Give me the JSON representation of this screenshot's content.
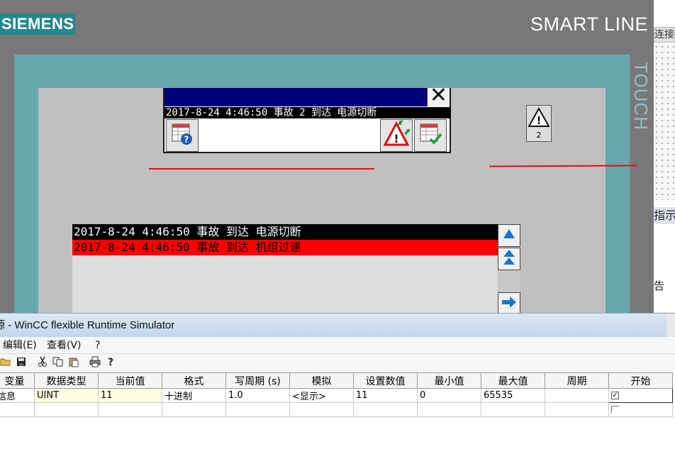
{
  "hmi": {
    "brand": "SIEMENS",
    "model": "SMART LINE",
    "side_label": "TOUCH",
    "alarm_window": {
      "message": "2017-8-24 4:46:50 事故 2 到达 电源切断",
      "close_symbol": "✕"
    },
    "alarm_indicator": {
      "count": "2"
    },
    "alarm_view": {
      "rows": [
        {
          "text": "2017-8-24 4:46:50 事故 到达 电源切断",
          "bg": "#000000",
          "fg": "#ffffff"
        },
        {
          "text": "2017-8-24 4:46:50 事故 到达 机组过速",
          "bg": "#ff0000",
          "fg": "#000000"
        }
      ]
    },
    "icons": {
      "help": "help-icon",
      "ack": "acknowledge-icon",
      "edit": "edit-table-icon",
      "scroll_up": "arrow-up-icon",
      "page_up": "double-arrow-up-icon",
      "enter": "arrow-right-icon"
    },
    "colors": {
      "frame": "#787878",
      "bezel": "#67a7ae",
      "screen": "#c0c0c0",
      "title": "#00007a"
    }
  },
  "background_window": {
    "tab": "连接",
    "text1": "指示",
    "text2": "告"
  },
  "simulator": {
    "title": "源 - WinCC flexible Runtime Simulator",
    "menu": [
      "编辑(E)",
      "查看(V)",
      "?"
    ],
    "toolbar": [
      "open-icon",
      "save-icon",
      "cut-icon",
      "copy-icon",
      "paste-icon",
      "print-icon",
      "help-icon"
    ],
    "table": {
      "headers": [
        "变量",
        "数据类型",
        "当前值",
        "格式",
        "写周期 (s)",
        "模拟",
        "设置数值",
        "最小值",
        "最大值",
        "周期",
        "开始"
      ],
      "rows": [
        [
          "信息",
          "UINT",
          "11",
          "十进制",
          "1.0",
          "<显示>",
          "11",
          "0",
          "65535",
          "",
          "checked"
        ],
        [
          "",
          "",
          "",
          "",
          "",
          "",
          "",
          "",
          "",
          "",
          "unchecked"
        ]
      ]
    }
  }
}
